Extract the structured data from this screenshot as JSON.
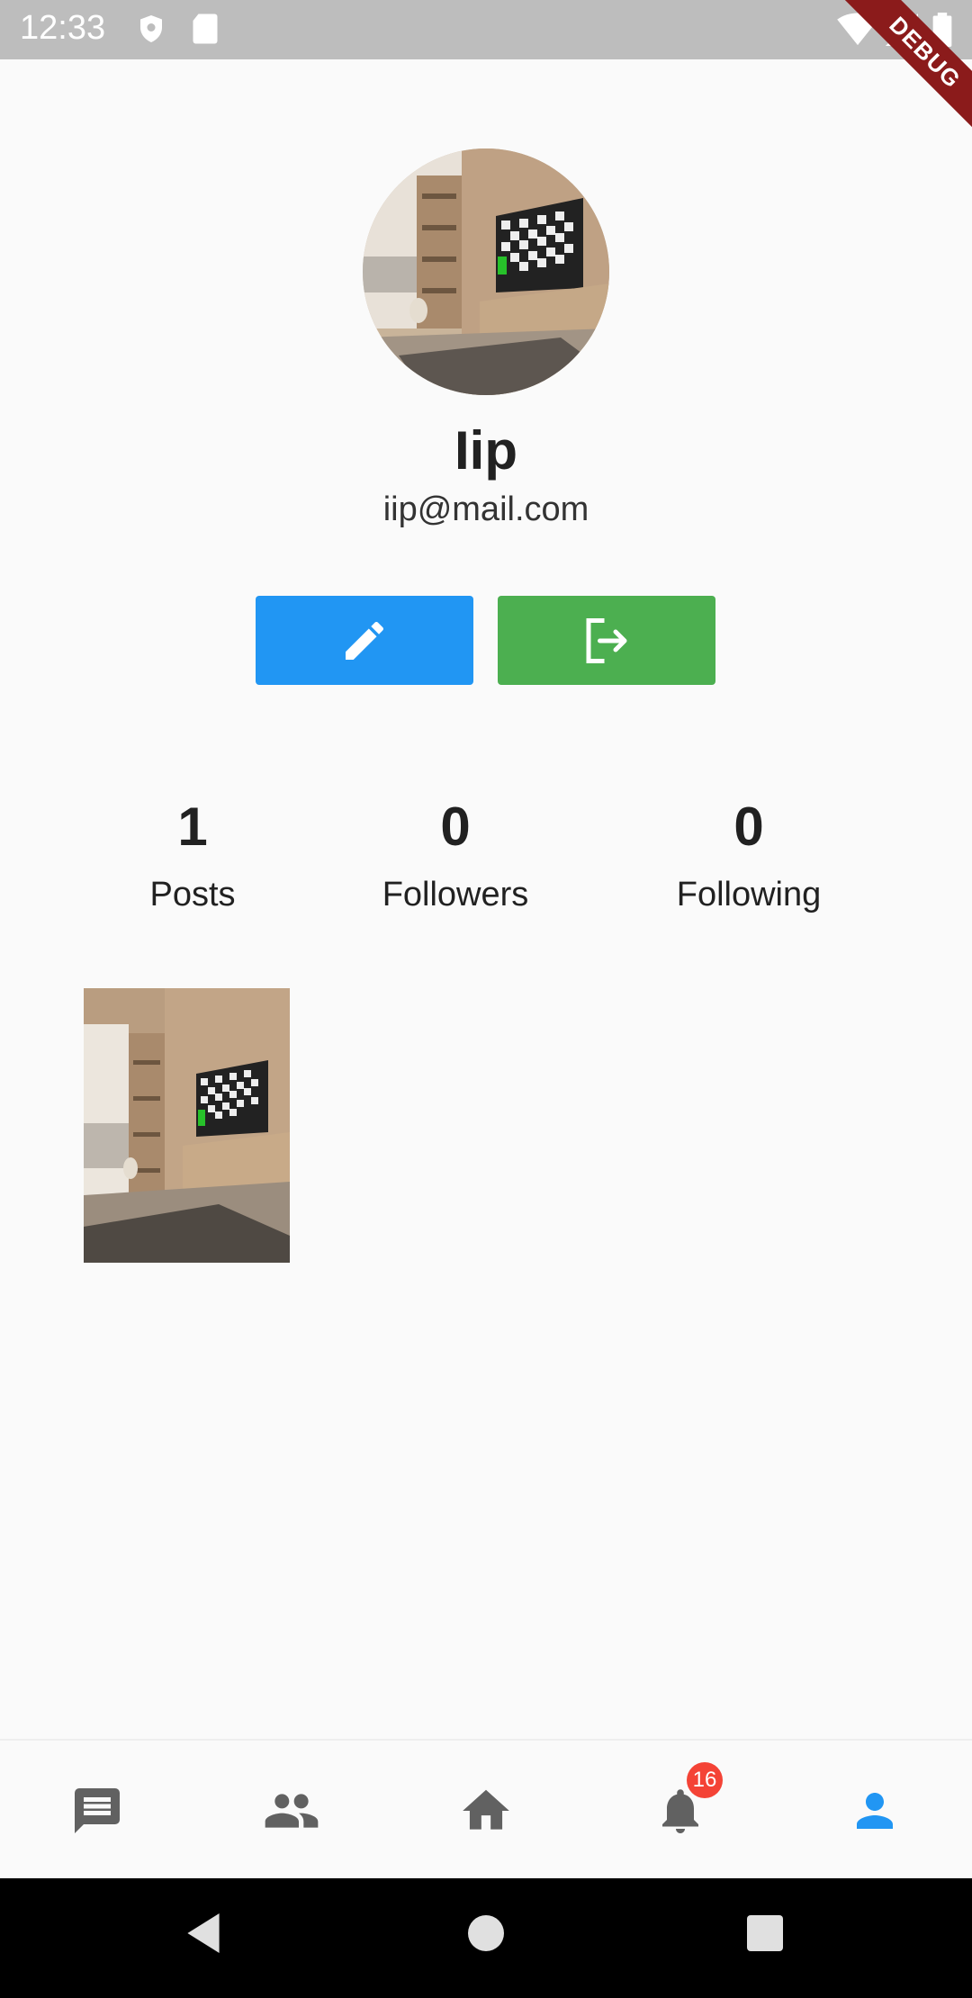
{
  "status_bar": {
    "time": "12:33",
    "debug_label": "DEBUG"
  },
  "profile": {
    "name": "Iip",
    "email": "iip@mail.com",
    "avatar_icon": "living-room-photo"
  },
  "actions": {
    "edit_icon": "pencil-icon",
    "logout_icon": "logout-icon"
  },
  "stats": [
    {
      "value": "1",
      "label": "Posts"
    },
    {
      "value": "0",
      "label": "Followers"
    },
    {
      "value": "0",
      "label": "Following"
    }
  ],
  "posts": [
    {
      "image": "living-room-photo"
    }
  ],
  "bottom_nav": {
    "items": [
      {
        "icon": "chat-icon"
      },
      {
        "icon": "people-icon"
      },
      {
        "icon": "home-icon"
      },
      {
        "icon": "bell-icon",
        "badge": "16"
      },
      {
        "icon": "person-icon",
        "active": true
      }
    ],
    "active_color": "#2196f3",
    "inactive_color": "#616161"
  },
  "colors": {
    "edit_button": "#2196f3",
    "logout_button": "#4caf50",
    "badge": "#f44336"
  }
}
